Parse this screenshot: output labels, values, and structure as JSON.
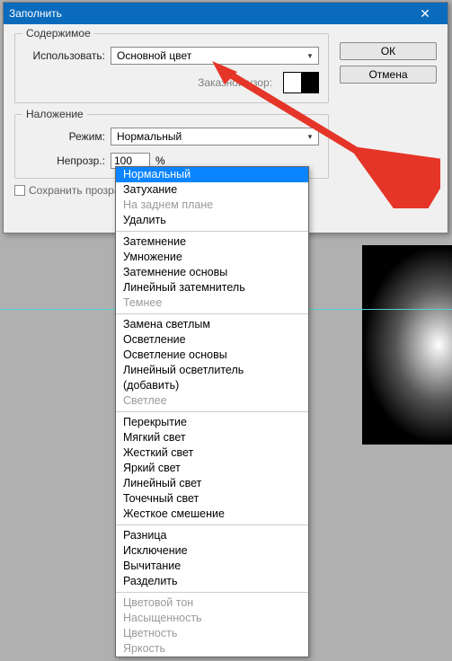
{
  "window": {
    "title": "Заполнить",
    "close_glyph": "✕"
  },
  "buttons": {
    "ok": "ОК",
    "cancel": "Отмена"
  },
  "content_group": {
    "title": "Содержимое",
    "use_label": "Использовать:",
    "use_value": "Основной цвет",
    "custom_label": "Заказной узор:"
  },
  "blend_group": {
    "title": "Наложение",
    "mode_label": "Режим:",
    "mode_value": "Нормальный",
    "opacity_label": "Непрозр.:",
    "opacity_value": "100",
    "opacity_unit": "%"
  },
  "preserve_checkbox": "Сохранить прозрачность",
  "dropdown": {
    "groups": [
      {
        "items": [
          {
            "label": "Нормальный",
            "selected": true
          },
          {
            "label": "Затухание"
          },
          {
            "label": "На заднем плане",
            "disabled": true
          },
          {
            "label": "Удалить"
          }
        ]
      },
      {
        "items": [
          {
            "label": "Затемнение"
          },
          {
            "label": "Умножение"
          },
          {
            "label": "Затемнение основы"
          },
          {
            "label": "Линейный затемнитель"
          },
          {
            "label": "Темнее",
            "disabled": true
          }
        ]
      },
      {
        "items": [
          {
            "label": "Замена светлым"
          },
          {
            "label": "Осветление"
          },
          {
            "label": "Осветление основы"
          },
          {
            "label": "Линейный осветлитель (добавить)"
          },
          {
            "label": "Светлее",
            "disabled": true
          }
        ]
      },
      {
        "items": [
          {
            "label": "Перекрытие"
          },
          {
            "label": "Мягкий свет"
          },
          {
            "label": "Жесткий свет"
          },
          {
            "label": "Яркий свет"
          },
          {
            "label": "Линейный свет"
          },
          {
            "label": "Точечный свет"
          },
          {
            "label": "Жесткое смешение"
          }
        ]
      },
      {
        "items": [
          {
            "label": "Разница"
          },
          {
            "label": "Исключение"
          },
          {
            "label": "Вычитание"
          },
          {
            "label": "Разделить"
          }
        ]
      },
      {
        "items": [
          {
            "label": "Цветовой тон",
            "disabled": true
          },
          {
            "label": "Насыщенность",
            "disabled": true
          },
          {
            "label": "Цветность",
            "disabled": true
          },
          {
            "label": "Яркость",
            "disabled": true
          }
        ]
      }
    ]
  },
  "annotation_arrow_color": "#e53528"
}
